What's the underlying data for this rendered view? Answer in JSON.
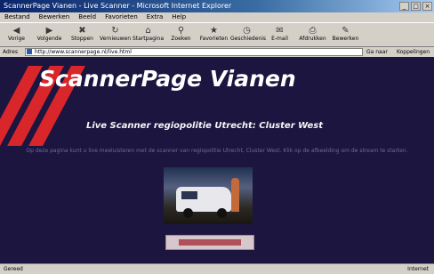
{
  "browser": {
    "title": "ScannerPage Vianen - Live Scanner - Microsoft Internet Explorer",
    "menu": [
      "Bestand",
      "Bewerken",
      "Beeld",
      "Favorieten",
      "Extra",
      "Help"
    ],
    "toolbar": [
      {
        "label": "Vorige",
        "icon": "back-icon"
      },
      {
        "label": "Volgende",
        "icon": "forward-icon"
      },
      {
        "label": "Stoppen",
        "icon": "stop-icon"
      },
      {
        "label": "Vernieuwen",
        "icon": "refresh-icon"
      },
      {
        "label": "Startpagina",
        "icon": "home-icon"
      },
      {
        "label": "Zoeken",
        "icon": "search-icon"
      },
      {
        "label": "Favorieten",
        "icon": "favorites-icon"
      },
      {
        "label": "Geschiedenis",
        "icon": "history-icon"
      },
      {
        "label": "E-mail",
        "icon": "mail-icon"
      },
      {
        "label": "Afdrukken",
        "icon": "print-icon"
      },
      {
        "label": "Bewerken",
        "icon": "edit-icon"
      }
    ],
    "address_label": "Adres",
    "address_value": "http://www.scannerpage.nl/live.html",
    "go_label": "Ga naar",
    "links_label": "Koppelingen",
    "status_left": "Gereed",
    "status_right": "Internet"
  },
  "page": {
    "site_title": "ScannerPage Vianen",
    "subtitle": "Live Scanner regiopolitie Utrecht: Cluster West",
    "blurb": "Op deze pagina kunt u live meeluisteren met de scanner van regiopolitie Utrecht, Cluster West. Klik op de afbeelding om de stream te starten.",
    "colors": {
      "background": "#1b1540",
      "stripes": "#d8262a",
      "title": "#ffffff"
    }
  }
}
